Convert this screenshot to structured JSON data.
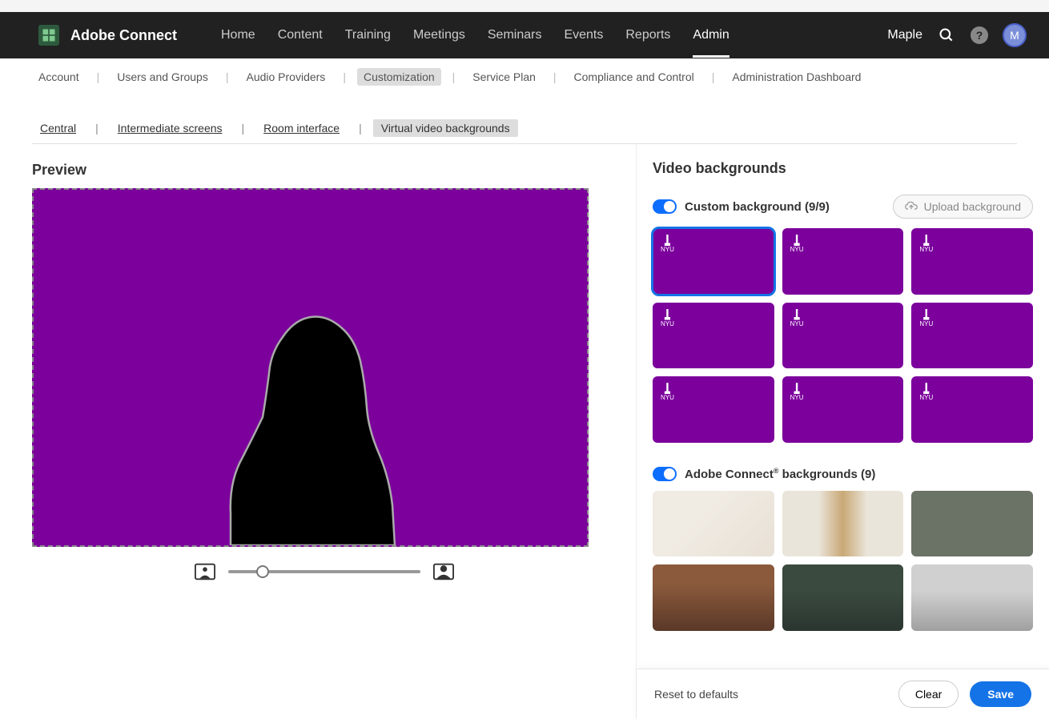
{
  "app_name": "Adobe Connect",
  "main_nav": [
    "Home",
    "Content",
    "Training",
    "Meetings",
    "Seminars",
    "Events",
    "Reports",
    "Admin"
  ],
  "main_nav_active": 7,
  "user": {
    "name": "Maple",
    "initial": "M"
  },
  "sub_nav": [
    "Account",
    "Users and Groups",
    "Audio Providers",
    "Customization",
    "Service Plan",
    "Compliance and Control",
    "Administration Dashboard"
  ],
  "sub_nav_active": 3,
  "bc_tabs": [
    "Central",
    "Intermediate screens",
    "Room interface",
    "Virtual video backgrounds"
  ],
  "bc_active": 3,
  "preview": {
    "title": "Preview"
  },
  "side": {
    "title": "Video backgrounds",
    "custom_label": "Custom background (9/9)",
    "upload_label": "Upload background",
    "custom_count": 9,
    "adobe_label_pre": "Adobe Connect",
    "adobe_label_post": " backgrounds (9)",
    "adobe_count": 6,
    "nyu_text": "NYU"
  },
  "footer": {
    "reset": "Reset to defaults",
    "clear": "Clear",
    "save": "Save"
  },
  "help_glyph": "?"
}
